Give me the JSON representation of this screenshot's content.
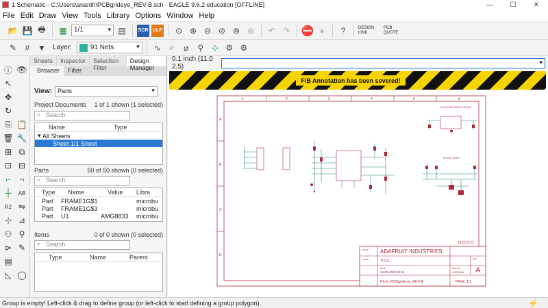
{
  "window": {
    "title": "1 Schematic - C:\\Users\\ananth\\PCBgrideye_REV-B.sch - EAGLE 9.6.2 education [OFFLINE]"
  },
  "menu": [
    "File",
    "Edit",
    "Draw",
    "View",
    "Tools",
    "Library",
    "Options",
    "Window",
    "Help"
  ],
  "toolbar": {
    "sheet_select": "1/1",
    "scr": "SCR",
    "ulp": "ULP",
    "design_link": "DESIGN LINK",
    "pcb_quote": "PCB QUOTE"
  },
  "toolbar2": {
    "layer_label": "Layer:",
    "layer_value": "91 Nets"
  },
  "panel": {
    "tabs": [
      "Sheets",
      "Inspector",
      "Selection Filter",
      "Design Manager"
    ],
    "subtabs": [
      "Browser",
      "Filter"
    ],
    "view_label": "View:",
    "view_value": "Parts",
    "project": {
      "title": "Project Documents",
      "count": "1 of 1 shown (1 selected)",
      "search": "Search",
      "headers": [
        "Name",
        "Type"
      ],
      "tree": [
        "All Sheets",
        "Sheet 1/1   Sheet"
      ]
    },
    "parts": {
      "title": "Parts",
      "count": "50 of 50 shown (0 selected)",
      "search": "Search",
      "headers": [
        "Type",
        "Name",
        "Value",
        "Libra"
      ],
      "rows": [
        [
          "Part",
          "FRAME1G$1",
          "",
          "microbu"
        ],
        [
          "Part",
          "FRAME1G$3",
          "",
          "microbu"
        ],
        [
          "Part",
          "U1",
          "AMG8833",
          "microbu"
        ]
      ]
    },
    "items": {
      "title": "Items",
      "count": "0 of 0 shown (0 selected)",
      "search": "Search",
      "headers": [
        "Type",
        "Name",
        "Parent"
      ]
    }
  },
  "canvas": {
    "grid": "0.1 inch (11.0 2.5)",
    "banner": "F/B Annotation has been severed!",
    "frame_cols": [
      "1",
      "2",
      "3",
      "4",
      "5",
      "6"
    ],
    "frame_rows": [
      "A",
      "B",
      "C",
      "D"
    ],
    "titleblock": {
      "company": "ADAFRUIT INDUSTRIES",
      "title": "TITLE",
      "date": "13-09-2020 13:01",
      "file": "FILE: PCBgrideye_REV-B",
      "rev": "A",
      "page": "PAGE: 1/1",
      "drawn": "DRAWN: >DRAWN",
      "date_label": "DATE",
      "title_label": "TITLE",
      "issue": "ISSUE",
      "rev_label": "REV",
      "drw_label": "DRW NR",
      "drw_value": ">DRAWN"
    },
    "block_voltage": "VOLTAGE REGULATION",
    "block_level": "LEVEL SHIFT"
  },
  "status": "Group is empty! Left-click & drag to define group (or left-click to start defining a group polygon)"
}
